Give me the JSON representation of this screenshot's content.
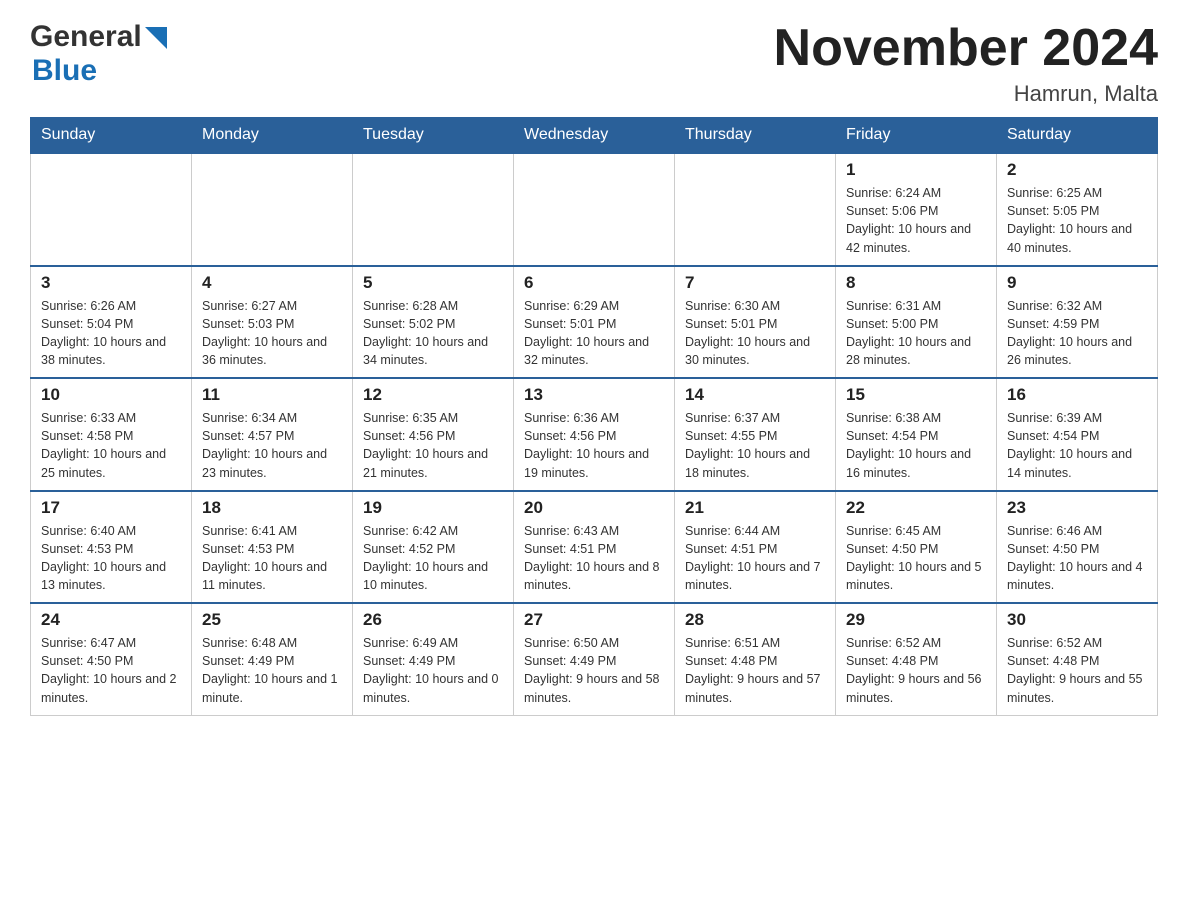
{
  "header": {
    "logo_general": "General",
    "logo_blue": "Blue",
    "month_title": "November 2024",
    "location": "Hamrun, Malta"
  },
  "days_of_week": [
    "Sunday",
    "Monday",
    "Tuesday",
    "Wednesday",
    "Thursday",
    "Friday",
    "Saturday"
  ],
  "weeks": [
    [
      {
        "day": "",
        "info": ""
      },
      {
        "day": "",
        "info": ""
      },
      {
        "day": "",
        "info": ""
      },
      {
        "day": "",
        "info": ""
      },
      {
        "day": "",
        "info": ""
      },
      {
        "day": "1",
        "info": "Sunrise: 6:24 AM\nSunset: 5:06 PM\nDaylight: 10 hours and 42 minutes."
      },
      {
        "day": "2",
        "info": "Sunrise: 6:25 AM\nSunset: 5:05 PM\nDaylight: 10 hours and 40 minutes."
      }
    ],
    [
      {
        "day": "3",
        "info": "Sunrise: 6:26 AM\nSunset: 5:04 PM\nDaylight: 10 hours and 38 minutes."
      },
      {
        "day": "4",
        "info": "Sunrise: 6:27 AM\nSunset: 5:03 PM\nDaylight: 10 hours and 36 minutes."
      },
      {
        "day": "5",
        "info": "Sunrise: 6:28 AM\nSunset: 5:02 PM\nDaylight: 10 hours and 34 minutes."
      },
      {
        "day": "6",
        "info": "Sunrise: 6:29 AM\nSunset: 5:01 PM\nDaylight: 10 hours and 32 minutes."
      },
      {
        "day": "7",
        "info": "Sunrise: 6:30 AM\nSunset: 5:01 PM\nDaylight: 10 hours and 30 minutes."
      },
      {
        "day": "8",
        "info": "Sunrise: 6:31 AM\nSunset: 5:00 PM\nDaylight: 10 hours and 28 minutes."
      },
      {
        "day": "9",
        "info": "Sunrise: 6:32 AM\nSunset: 4:59 PM\nDaylight: 10 hours and 26 minutes."
      }
    ],
    [
      {
        "day": "10",
        "info": "Sunrise: 6:33 AM\nSunset: 4:58 PM\nDaylight: 10 hours and 25 minutes."
      },
      {
        "day": "11",
        "info": "Sunrise: 6:34 AM\nSunset: 4:57 PM\nDaylight: 10 hours and 23 minutes."
      },
      {
        "day": "12",
        "info": "Sunrise: 6:35 AM\nSunset: 4:56 PM\nDaylight: 10 hours and 21 minutes."
      },
      {
        "day": "13",
        "info": "Sunrise: 6:36 AM\nSunset: 4:56 PM\nDaylight: 10 hours and 19 minutes."
      },
      {
        "day": "14",
        "info": "Sunrise: 6:37 AM\nSunset: 4:55 PM\nDaylight: 10 hours and 18 minutes."
      },
      {
        "day": "15",
        "info": "Sunrise: 6:38 AM\nSunset: 4:54 PM\nDaylight: 10 hours and 16 minutes."
      },
      {
        "day": "16",
        "info": "Sunrise: 6:39 AM\nSunset: 4:54 PM\nDaylight: 10 hours and 14 minutes."
      }
    ],
    [
      {
        "day": "17",
        "info": "Sunrise: 6:40 AM\nSunset: 4:53 PM\nDaylight: 10 hours and 13 minutes."
      },
      {
        "day": "18",
        "info": "Sunrise: 6:41 AM\nSunset: 4:53 PM\nDaylight: 10 hours and 11 minutes."
      },
      {
        "day": "19",
        "info": "Sunrise: 6:42 AM\nSunset: 4:52 PM\nDaylight: 10 hours and 10 minutes."
      },
      {
        "day": "20",
        "info": "Sunrise: 6:43 AM\nSunset: 4:51 PM\nDaylight: 10 hours and 8 minutes."
      },
      {
        "day": "21",
        "info": "Sunrise: 6:44 AM\nSunset: 4:51 PM\nDaylight: 10 hours and 7 minutes."
      },
      {
        "day": "22",
        "info": "Sunrise: 6:45 AM\nSunset: 4:50 PM\nDaylight: 10 hours and 5 minutes."
      },
      {
        "day": "23",
        "info": "Sunrise: 6:46 AM\nSunset: 4:50 PM\nDaylight: 10 hours and 4 minutes."
      }
    ],
    [
      {
        "day": "24",
        "info": "Sunrise: 6:47 AM\nSunset: 4:50 PM\nDaylight: 10 hours and 2 minutes."
      },
      {
        "day": "25",
        "info": "Sunrise: 6:48 AM\nSunset: 4:49 PM\nDaylight: 10 hours and 1 minute."
      },
      {
        "day": "26",
        "info": "Sunrise: 6:49 AM\nSunset: 4:49 PM\nDaylight: 10 hours and 0 minutes."
      },
      {
        "day": "27",
        "info": "Sunrise: 6:50 AM\nSunset: 4:49 PM\nDaylight: 9 hours and 58 minutes."
      },
      {
        "day": "28",
        "info": "Sunrise: 6:51 AM\nSunset: 4:48 PM\nDaylight: 9 hours and 57 minutes."
      },
      {
        "day": "29",
        "info": "Sunrise: 6:52 AM\nSunset: 4:48 PM\nDaylight: 9 hours and 56 minutes."
      },
      {
        "day": "30",
        "info": "Sunrise: 6:52 AM\nSunset: 4:48 PM\nDaylight: 9 hours and 55 minutes."
      }
    ]
  ]
}
